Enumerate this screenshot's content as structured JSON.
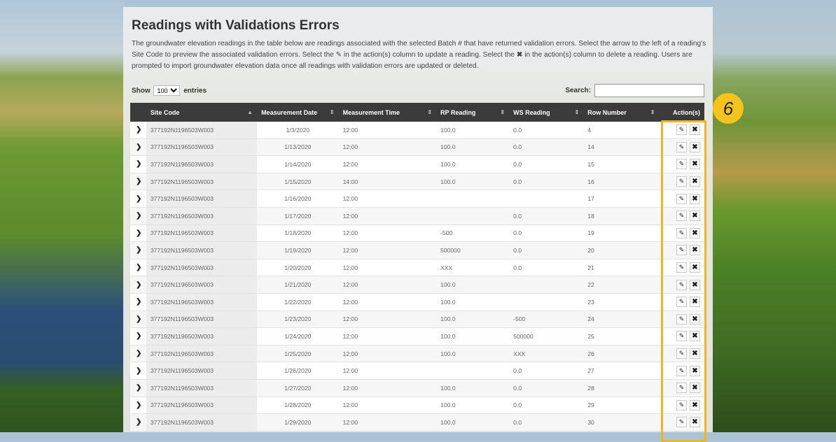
{
  "title": "Readings with Validations Errors",
  "description": {
    "part1": "The groundwater elevation readings in the table below are readings associated with the selected Batch # that have returned validation errors. Select the arrow to the left of a reading's Site Code to preview the associated validation errors. Select the",
    "part2": "in the action(s) column to update a reading. Select the",
    "part3": "in the action(s) column to delete a reading. Users are prompted to import groundwater elevation data once all readings with validation errors are updated or deleted."
  },
  "controls": {
    "show_label": "Show",
    "entries_value": "100",
    "entries_label": "entries",
    "search_label": "Search:",
    "search_value": ""
  },
  "columns": [
    "Site Code",
    "Measurement Date",
    "Measurement Time",
    "RP Reading",
    "WS Reading",
    "Row Number",
    "Action(s)"
  ],
  "rows": [
    {
      "site": "377192N1196503W003",
      "date": "1/3/2020",
      "time": "12:00",
      "rp": "100.0",
      "ws": "0.0",
      "row": "4"
    },
    {
      "site": "377192N1196503W003",
      "date": "1/13/2020",
      "time": "12:00",
      "rp": "100.0",
      "ws": "0.0",
      "row": "14"
    },
    {
      "site": "377192N1196503W003",
      "date": "1/14/2020",
      "time": "12:00",
      "rp": "100.0",
      "ws": "0.0",
      "row": "15"
    },
    {
      "site": "377192N1196503W003",
      "date": "1/15/2020",
      "time": "14:00",
      "rp": "100.0",
      "ws": "0.0",
      "row": "16"
    },
    {
      "site": "377192N1196503W003",
      "date": "1/16/2020",
      "time": "12:00",
      "rp": "",
      "ws": "",
      "row": "17"
    },
    {
      "site": "377192N1196503W003",
      "date": "1/17/2020",
      "time": "12:00",
      "rp": "",
      "ws": "0.0",
      "row": "18"
    },
    {
      "site": "377192N1196503W003",
      "date": "1/18/2020",
      "time": "12:00",
      "rp": "-500",
      "ws": "0.0",
      "row": "19"
    },
    {
      "site": "377192N1196503W003",
      "date": "1/19/2020",
      "time": "12:00",
      "rp": "500000",
      "ws": "0.0",
      "row": "20"
    },
    {
      "site": "377192N1196503W003",
      "date": "1/20/2020",
      "time": "12:00",
      "rp": "XXX",
      "ws": "0.0",
      "row": "21"
    },
    {
      "site": "377192N1196503W003",
      "date": "1/21/2020",
      "time": "12:00",
      "rp": "100.0",
      "ws": "",
      "row": "22"
    },
    {
      "site": "377192N1196503W003",
      "date": "1/22/2020",
      "time": "12:00",
      "rp": "100.0",
      "ws": "",
      "row": "23"
    },
    {
      "site": "377192N1196503W003",
      "date": "1/23/2020",
      "time": "12:00",
      "rp": "100.0",
      "ws": "-500",
      "row": "24"
    },
    {
      "site": "377192N1196503W003",
      "date": "1/24/2020",
      "time": "12:00",
      "rp": "100.0",
      "ws": "500000",
      "row": "25"
    },
    {
      "site": "377192N1196503W003",
      "date": "1/25/2020",
      "time": "12:00",
      "rp": "100.0",
      "ws": "XXX",
      "row": "26"
    },
    {
      "site": "377192N1196503W003",
      "date": "1/26/2020",
      "time": "12:00",
      "rp": "",
      "ws": "0.0",
      "row": "27"
    },
    {
      "site": "377192N1196503W003",
      "date": "1/27/2020",
      "time": "12:00",
      "rp": "100.0",
      "ws": "0.0",
      "row": "28"
    },
    {
      "site": "377192N1196503W003",
      "date": "1/28/2020",
      "time": "12:00",
      "rp": "100.0",
      "ws": "0.0",
      "row": "29"
    },
    {
      "site": "377192N1196503W003",
      "date": "1/29/2020",
      "time": "12:00",
      "rp": "100.0",
      "ws": "0.0",
      "row": "30"
    }
  ],
  "icons": {
    "expand": "chevron-right-icon",
    "edit": "pencil-icon",
    "delete": "times-icon"
  },
  "annotation": {
    "step_number": "6",
    "highlight_color": "#f2b61c"
  }
}
